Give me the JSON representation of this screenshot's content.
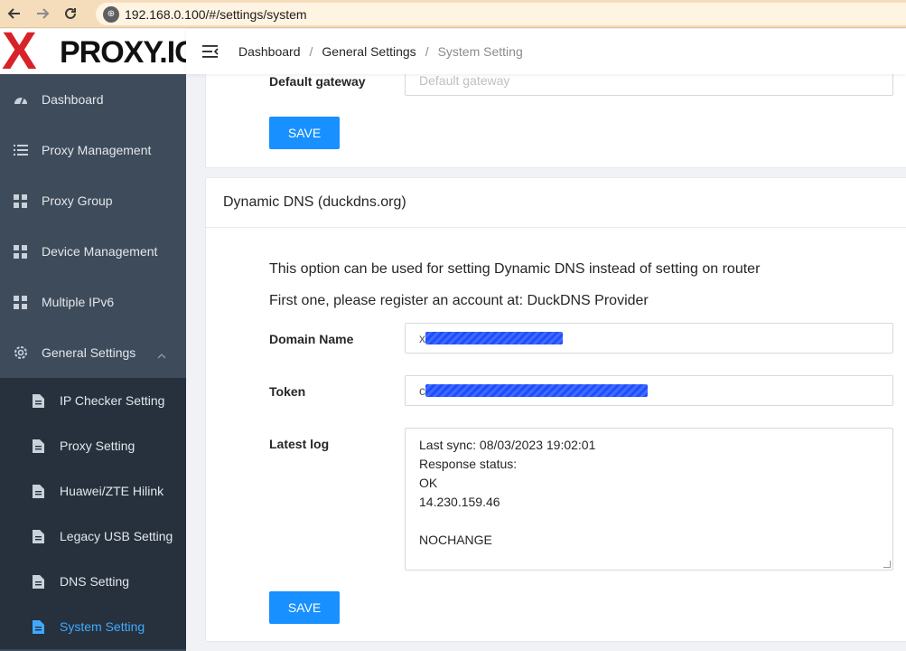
{
  "browser": {
    "url": "192.168.0.100/#/settings/system"
  },
  "sidebar": {
    "logo_x": "X",
    "logo_text": "PROXY.IO",
    "items": [
      {
        "label": "Dashboard",
        "icon": "dashboard-icon"
      },
      {
        "label": "Proxy Management",
        "icon": "list-icon"
      },
      {
        "label": "Proxy Group",
        "icon": "grid-icon"
      },
      {
        "label": "Device Management",
        "icon": "grid-icon"
      },
      {
        "label": "Multiple IPv6",
        "icon": "grid-icon"
      },
      {
        "label": "General Settings",
        "icon": "gear-icon"
      }
    ],
    "sub_items": [
      {
        "label": "IP Checker Setting",
        "icon": "file-icon"
      },
      {
        "label": "Proxy Setting",
        "icon": "file-icon"
      },
      {
        "label": "Huawei/ZTE Hilink",
        "icon": "file-icon"
      },
      {
        "label": "Legacy USB Setting",
        "icon": "file-icon"
      },
      {
        "label": "DNS Setting",
        "icon": "file-icon"
      },
      {
        "label": "System Setting",
        "icon": "file-icon"
      }
    ],
    "active_color": "#40a9ff"
  },
  "header": {
    "breadcrumb": [
      "Dashboard",
      "General Settings",
      "System Setting"
    ],
    "separator": "/"
  },
  "network_card": {
    "gateway_label": "Default gateway",
    "gateway_placeholder": "Default gateway",
    "save_label": "SAVE"
  },
  "ddns_card": {
    "title": "Dynamic DNS (duckdns.org)",
    "desc_1": "This option can be used for setting Dynamic DNS instead of setting on router",
    "desc_2": "First one, please register an account at: DuckDNS Provider",
    "domain_label": "Domain Name",
    "domain_value_prefix": "x",
    "token_label": "Token",
    "token_value_prefix": "c",
    "log_label": "Latest log",
    "log_lines": [
      "Last sync: 08/03/2023 19:02:01",
      "Response status:",
      "OK",
      "14.230.159.46",
      "",
      "NOCHANGE"
    ],
    "save_label": "SAVE"
  },
  "colors": {
    "primary": "#1890ff",
    "sidebar_bg": "#3e4b5a",
    "submenu_bg": "#26313d",
    "logo_red": "#d8222a"
  }
}
